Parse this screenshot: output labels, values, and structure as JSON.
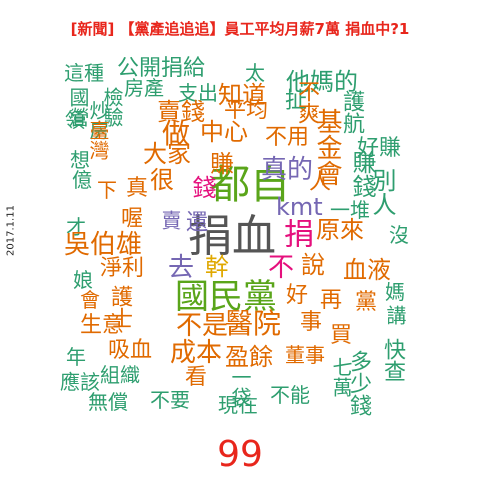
{
  "title": "[新聞] 【黨產追追追】員工平均月薪7萬 捐血中?1",
  "side_date": "2017.1.11",
  "footer_number": "99",
  "colors": {
    "green": "#2e9e6f",
    "orange": "#e06a00",
    "purple": "#7567b3",
    "pink": "#e5107d",
    "olive": "#5aa51a",
    "gold": "#e0a800",
    "gray": "#555555",
    "red": "#e8261c"
  },
  "words": [
    {
      "text": "捐血",
      "color": "gray"
    },
    {
      "text": "都自",
      "color": "olive"
    },
    {
      "text": "國民黨",
      "color": "olive"
    },
    {
      "text": "幹",
      "color": "gold"
    },
    {
      "text": "kmt",
      "color": "purple"
    },
    {
      "text": "捐",
      "color": "pink"
    },
    {
      "text": "不",
      "color": "pink"
    },
    {
      "text": "錢",
      "color": "pink"
    },
    {
      "text": "去",
      "color": "purple"
    },
    {
      "text": "還",
      "color": "purple"
    },
    {
      "text": "賣",
      "color": "purple"
    },
    {
      "text": "真的",
      "color": "purple"
    },
    {
      "text": "公開捐給",
      "color": "green"
    },
    {
      "text": "太",
      "color": "green"
    },
    {
      "text": "這種",
      "color": "green"
    },
    {
      "text": "房產",
      "color": "green"
    },
    {
      "text": "支出",
      "color": "green"
    },
    {
      "text": "知道",
      "color": "orange"
    },
    {
      "text": "他媽的",
      "color": "green"
    },
    {
      "text": "護航",
      "color": "green"
    },
    {
      "text": "好賺",
      "color": "green"
    },
    {
      "text": "賺錢",
      "color": "green"
    },
    {
      "text": "基金會",
      "color": "orange"
    },
    {
      "text": "別人",
      "color": "green"
    },
    {
      "text": "扯",
      "color": "green"
    },
    {
      "text": "不爽",
      "color": "orange"
    },
    {
      "text": "平均",
      "color": "orange"
    },
    {
      "text": "賣錢",
      "color": "orange"
    },
    {
      "text": "做",
      "color": "orange"
    },
    {
      "text": "中心",
      "color": "orange"
    },
    {
      "text": "不用",
      "color": "orange"
    },
    {
      "text": "大家",
      "color": "orange"
    },
    {
      "text": "賺",
      "color": "orange"
    },
    {
      "text": "人",
      "color": "orange"
    },
    {
      "text": "很",
      "color": "orange"
    },
    {
      "text": "真",
      "color": "orange"
    },
    {
      "text": "下",
      "color": "orange"
    },
    {
      "text": "國營",
      "color": "green"
    },
    {
      "text": "檢驗",
      "color": "green"
    },
    {
      "text": "領",
      "color": "green"
    },
    {
      "text": "炒房",
      "color": "green"
    },
    {
      "text": "臺灣",
      "color": "orange"
    },
    {
      "text": "想",
      "color": "green"
    },
    {
      "text": "億",
      "color": "green"
    },
    {
      "text": "才",
      "color": "green"
    },
    {
      "text": "吳伯雄",
      "color": "orange"
    },
    {
      "text": "娘",
      "color": "green"
    },
    {
      "text": "淨利",
      "color": "orange"
    },
    {
      "text": "喔",
      "color": "orange"
    },
    {
      "text": "一堆",
      "color": "green"
    },
    {
      "text": "原來",
      "color": "orange"
    },
    {
      "text": "沒",
      "color": "green"
    },
    {
      "text": "說",
      "color": "orange"
    },
    {
      "text": "血液",
      "color": "orange"
    },
    {
      "text": "好",
      "color": "orange"
    },
    {
      "text": "再",
      "color": "orange"
    },
    {
      "text": "黨",
      "color": "orange"
    },
    {
      "text": "媽",
      "color": "green"
    },
    {
      "text": "講",
      "color": "green"
    },
    {
      "text": "會",
      "color": "orange"
    },
    {
      "text": "護士",
      "color": "orange"
    },
    {
      "text": "生意",
      "color": "orange"
    },
    {
      "text": "不是",
      "color": "orange"
    },
    {
      "text": "醫院",
      "color": "orange"
    },
    {
      "text": "事",
      "color": "orange"
    },
    {
      "text": "買",
      "color": "orange"
    },
    {
      "text": "快查",
      "color": "green"
    },
    {
      "text": "年",
      "color": "green"
    },
    {
      "text": "吸血",
      "color": "orange"
    },
    {
      "text": "成本",
      "color": "orange"
    },
    {
      "text": "盈餘",
      "color": "orange"
    },
    {
      "text": "董事",
      "color": "orange"
    },
    {
      "text": "多少錢",
      "color": "green"
    },
    {
      "text": "應該",
      "color": "green"
    },
    {
      "text": "組織",
      "color": "green"
    },
    {
      "text": "看",
      "color": "orange"
    },
    {
      "text": "一袋",
      "color": "green"
    },
    {
      "text": "七萬",
      "color": "green"
    },
    {
      "text": "無償",
      "color": "green"
    },
    {
      "text": "不要",
      "color": "green"
    },
    {
      "text": "現在",
      "color": "green"
    },
    {
      "text": "不能",
      "color": "green"
    }
  ]
}
